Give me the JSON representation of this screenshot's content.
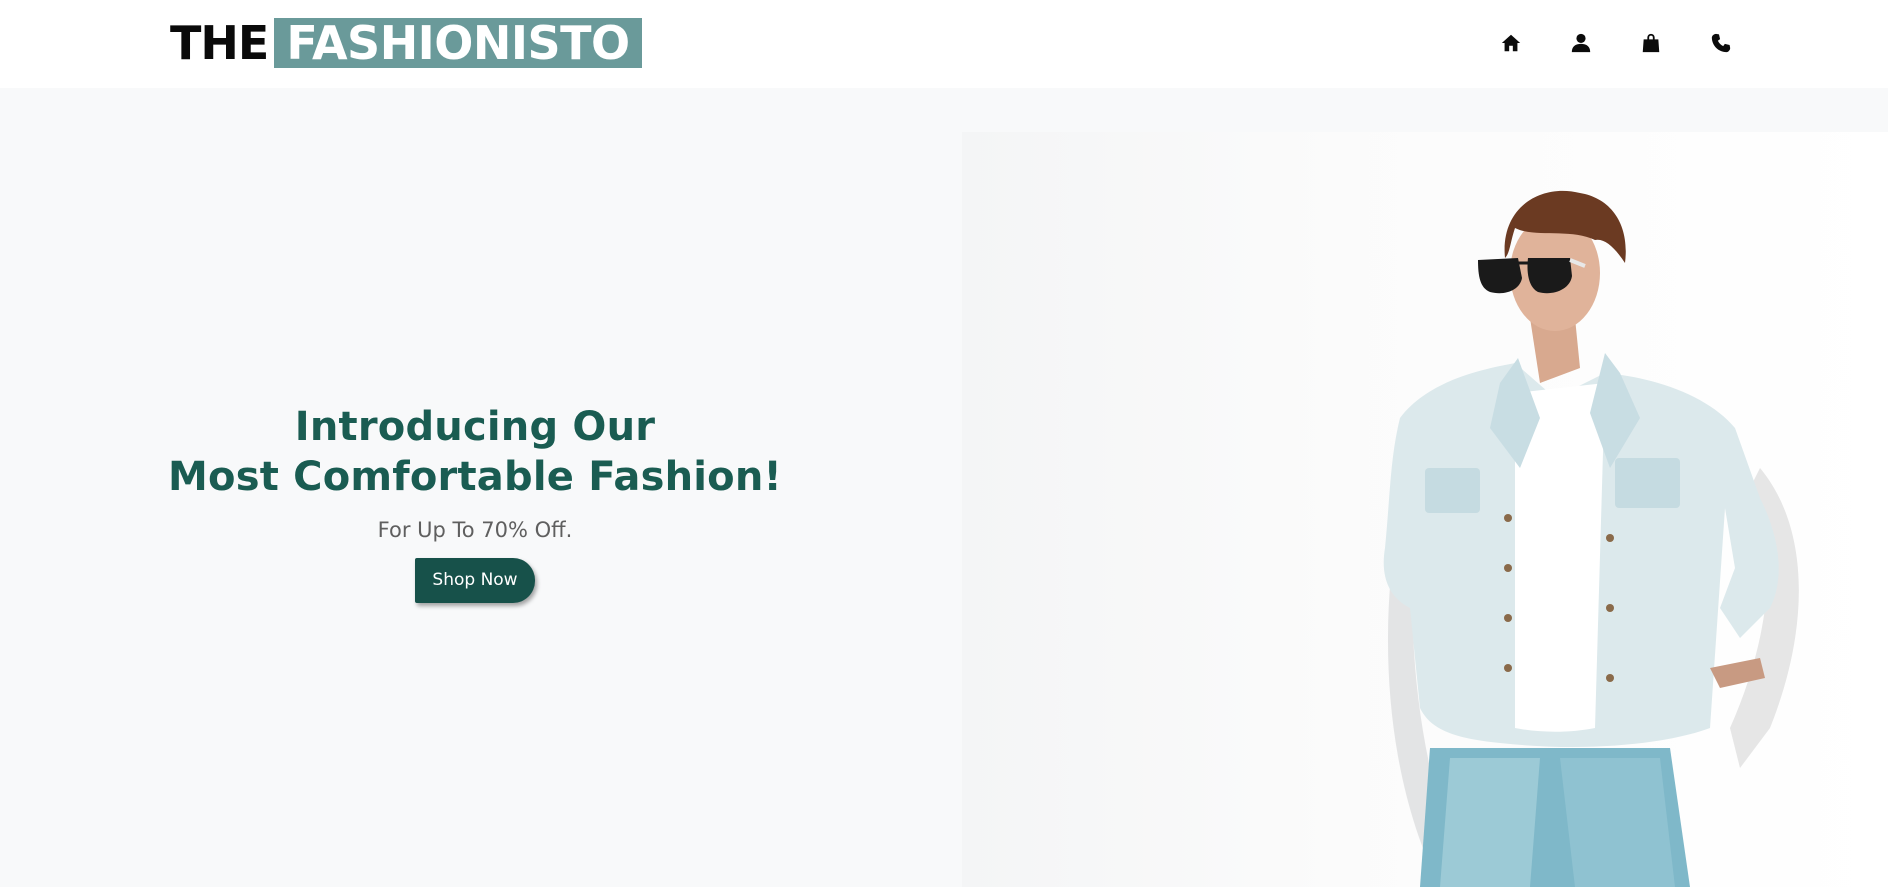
{
  "brand": {
    "part1": "THE",
    "part2": "FASHIONISTO",
    "accent_color": "#6a9a9a"
  },
  "nav": {
    "icons": [
      "home-icon",
      "user-icon",
      "shopping-bag-icon",
      "phone-icon"
    ]
  },
  "hero": {
    "title_line1": "Introducing Our",
    "title_line2": "Most Comfortable Fashion!",
    "subtitle": "For Up To 70% Off.",
    "cta_label": "Shop Now",
    "title_color": "#1a5c52",
    "cta_color": "#17514a"
  }
}
